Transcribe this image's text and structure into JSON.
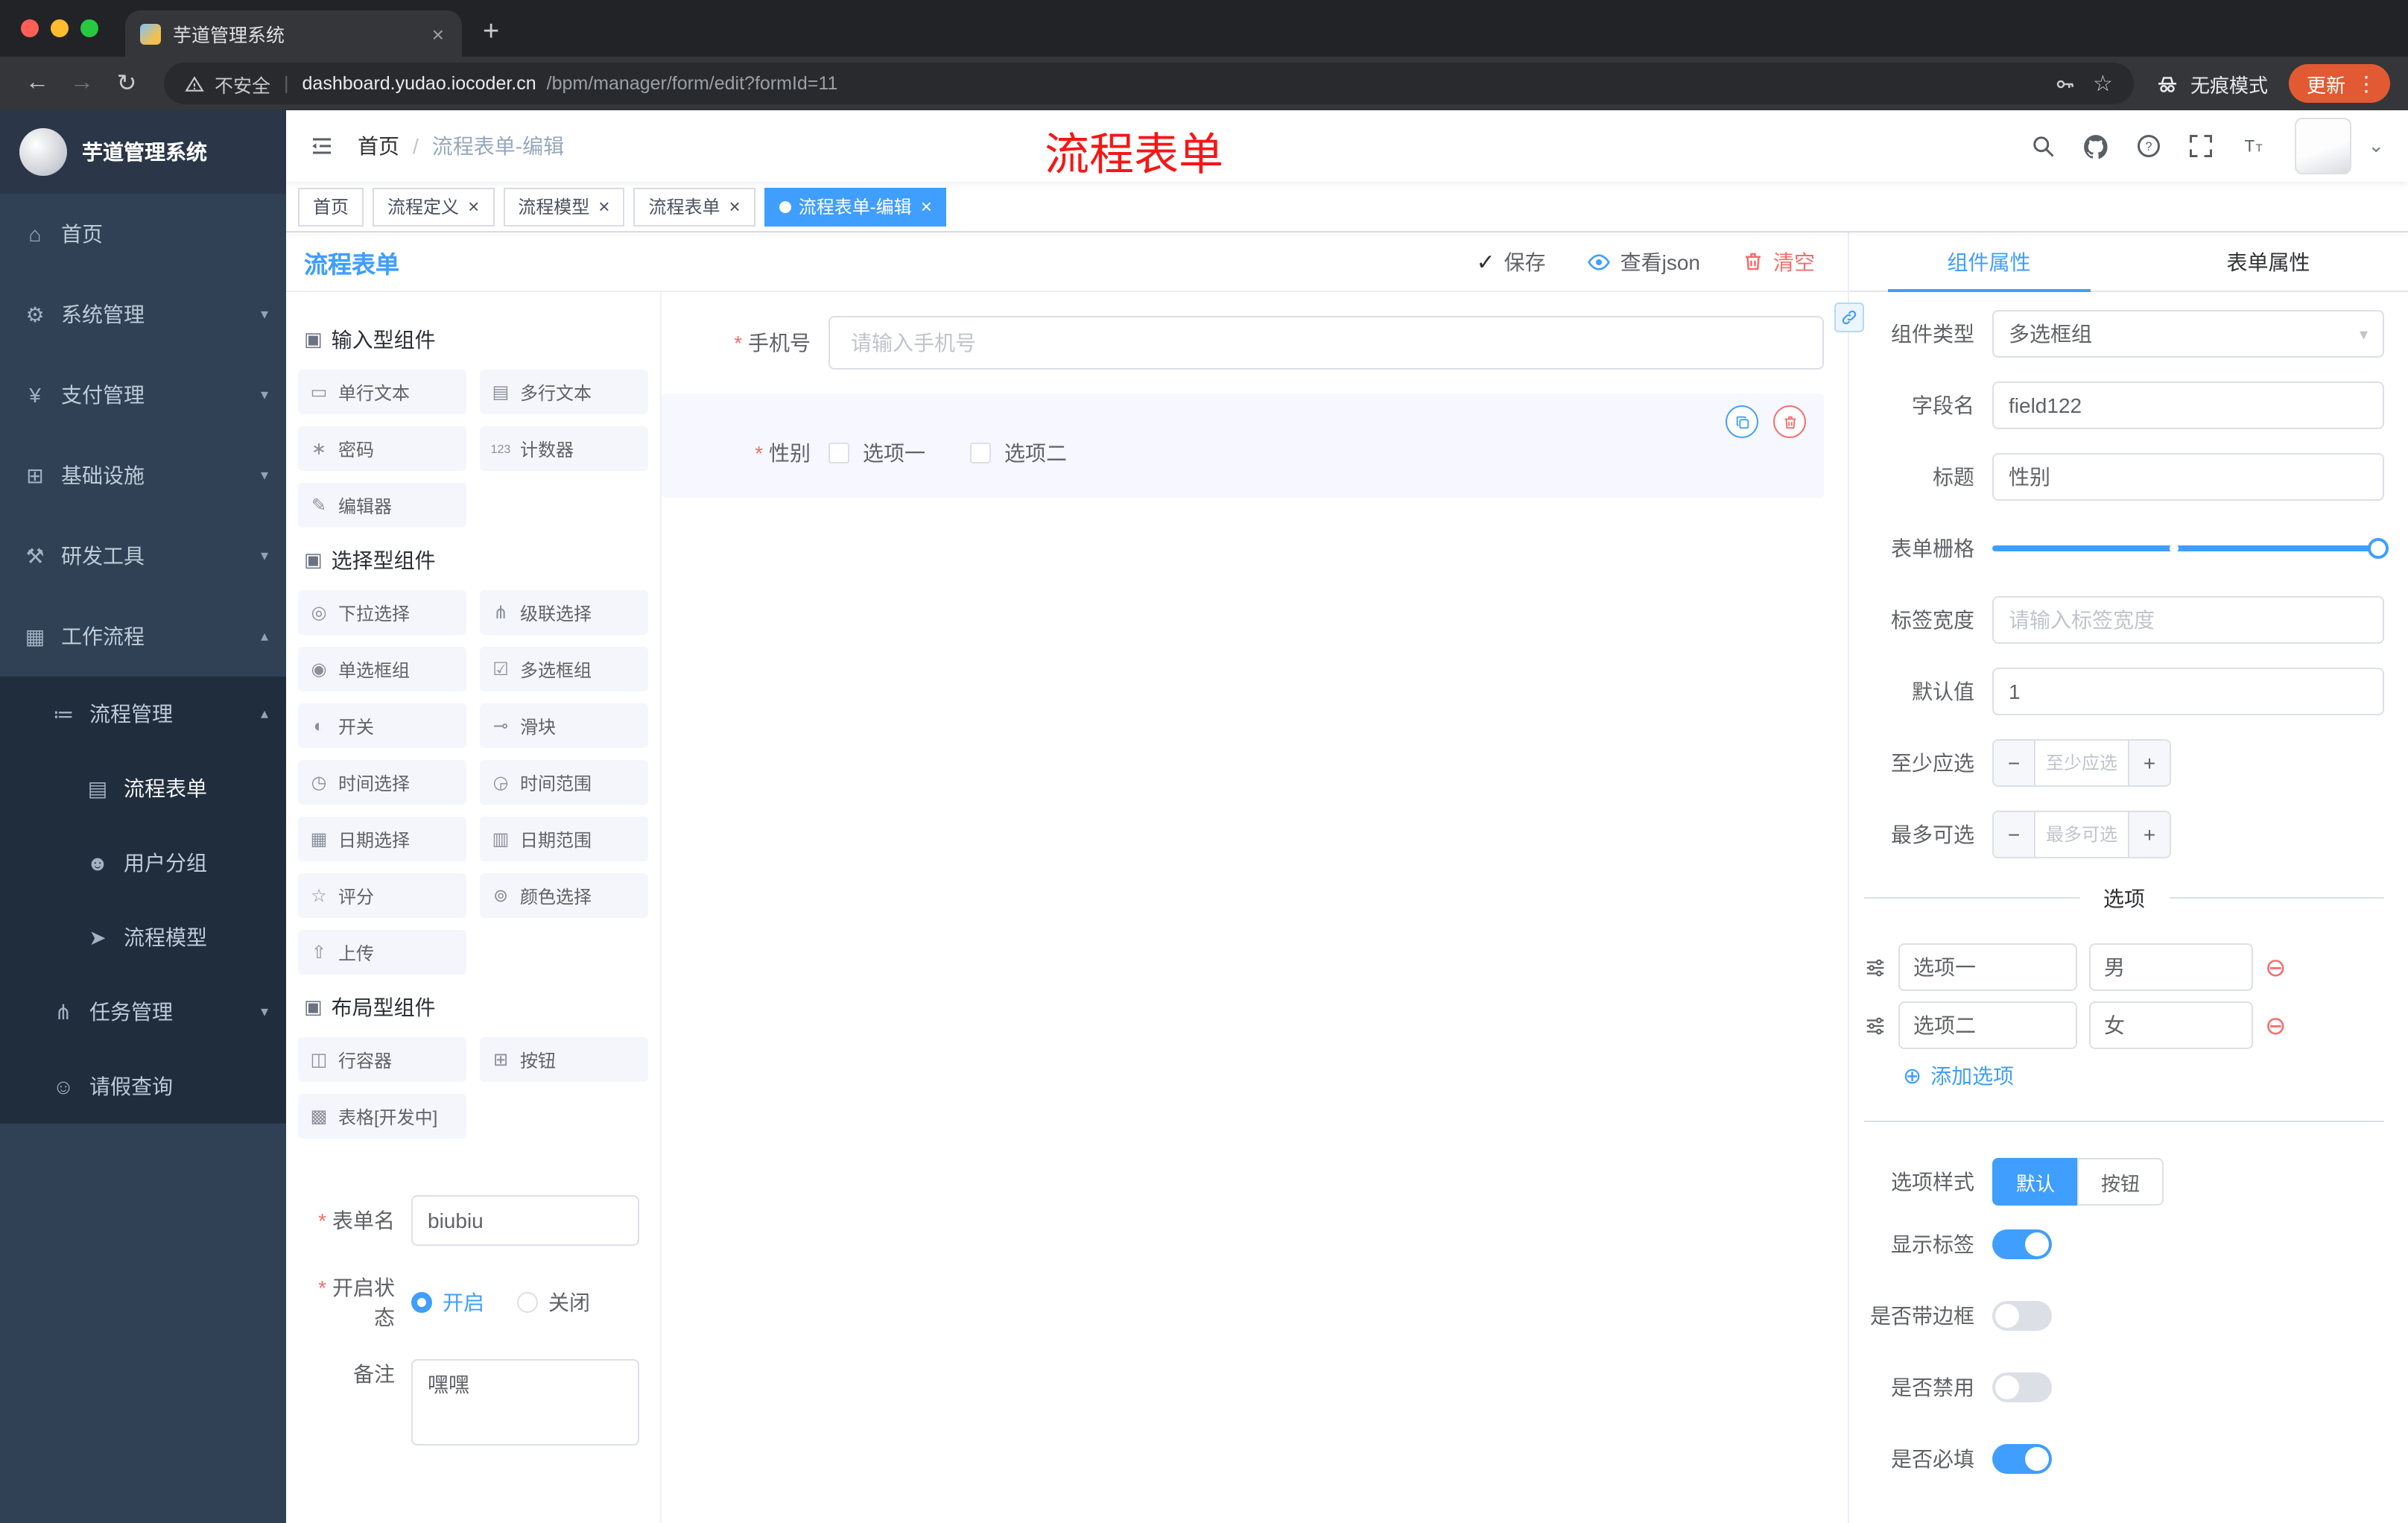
{
  "accent": "#409eff",
  "annotation_title": "流程表单",
  "browser": {
    "tab_title": "芋道管理系统",
    "security_label": "不安全",
    "url_host": "dashboard.yudao.iocoder.cn",
    "url_path": "/bpm/manager/form/edit?formId=11",
    "incognito_label": "无痕模式",
    "update_label": "更新"
  },
  "sidebar": {
    "logo_title": "芋道管理系统",
    "items": [
      {
        "icon": "⌂",
        "label": "首页",
        "arrow": ""
      },
      {
        "icon": "⚙",
        "label": "系统管理",
        "arrow": "▾"
      },
      {
        "icon": "¥",
        "label": "支付管理",
        "arrow": "▾"
      },
      {
        "icon": "⊞",
        "label": "基础设施",
        "arrow": "▾"
      },
      {
        "icon": "⚒",
        "label": "研发工具",
        "arrow": "▾"
      },
      {
        "icon": "▦",
        "label": "工作流程",
        "arrow": "▴"
      },
      {
        "icon": "≔",
        "label": "流程管理",
        "arrow": "▴"
      },
      {
        "icon": "▤",
        "label": "流程表单",
        "arrow": ""
      },
      {
        "icon": "☻",
        "label": "用户分组",
        "arrow": ""
      },
      {
        "icon": "➤",
        "label": "流程模型",
        "arrow": ""
      },
      {
        "icon": "⋔",
        "label": "任务管理",
        "arrow": "▾"
      },
      {
        "icon": "☺",
        "label": "请假查询",
        "arrow": ""
      }
    ]
  },
  "header": {
    "breadcrumb_home": "首页",
    "breadcrumb_sep": "/",
    "breadcrumb_current": "流程表单-编辑"
  },
  "tags": [
    {
      "label": "首页"
    },
    {
      "label": "流程定义"
    },
    {
      "label": "流程模型"
    },
    {
      "label": "流程表单"
    },
    {
      "label": "流程表单-编辑"
    }
  ],
  "designer": {
    "title": "流程表单",
    "actions": {
      "save": "保存",
      "view_json": "查看json",
      "clear": "清空"
    },
    "palette": {
      "groups": [
        {
          "title": "输入型组件",
          "items": [
            {
              "icon": "▭",
              "label": "单行文本"
            },
            {
              "icon": "▤",
              "label": "多行文本"
            },
            {
              "icon": "∗",
              "label": "密码"
            },
            {
              "icon": "123",
              "label": "计数器"
            },
            {
              "icon": "✎",
              "label": "编辑器"
            }
          ]
        },
        {
          "title": "选择型组件",
          "items": [
            {
              "icon": "◎",
              "label": "下拉选择"
            },
            {
              "icon": "⋔",
              "label": "级联选择"
            },
            {
              "icon": "◉",
              "label": "单选框组"
            },
            {
              "icon": "☑",
              "label": "多选框组"
            },
            {
              "icon": "◐",
              "label": "开关"
            },
            {
              "icon": "⊸",
              "label": "滑块"
            },
            {
              "icon": "◷",
              "label": "时间选择"
            },
            {
              "icon": "◶",
              "label": "时间范围"
            },
            {
              "icon": "▦",
              "label": "日期选择"
            },
            {
              "icon": "▥",
              "label": "日期范围"
            },
            {
              "icon": "☆",
              "label": "评分"
            },
            {
              "icon": "⊚",
              "label": "颜色选择"
            },
            {
              "icon": "⇧",
              "label": "上传"
            }
          ]
        },
        {
          "title": "布局型组件",
          "items": [
            {
              "icon": "◫",
              "label": "行容器"
            },
            {
              "icon": "⊞",
              "label": "按钮"
            },
            {
              "icon": "▩",
              "label": "表格[开发中]"
            }
          ]
        }
      ]
    },
    "meta": {
      "name_label": "表单名",
      "name_value": "biubiu",
      "status_label": "开启状态",
      "status_on": "开启",
      "status_off": "关闭",
      "remark_label": "备注",
      "remark_value": "嘿嘿"
    },
    "canvas": {
      "phone": {
        "label": "手机号",
        "placeholder": "请输入手机号"
      },
      "gender": {
        "label": "性别",
        "options": [
          "选项一",
          "选项二"
        ]
      }
    }
  },
  "props": {
    "tab_component": "组件属性",
    "tab_form": "表单属性",
    "rows": {
      "component_type": {
        "label": "组件类型",
        "value": "多选框组"
      },
      "field_name": {
        "label": "字段名",
        "value": "field122"
      },
      "title": {
        "label": "标题",
        "value": "性别"
      },
      "grid": {
        "label": "表单栅格"
      },
      "label_width": {
        "label": "标签宽度",
        "placeholder": "请输入标签宽度"
      },
      "default": {
        "label": "默认值",
        "value": "1"
      },
      "min": {
        "label": "至少应选",
        "placeholder": "至少应选"
      },
      "max": {
        "label": "最多可选",
        "placeholder": "最多可选"
      }
    },
    "options_divider": "选项",
    "options": [
      {
        "label": "选项一",
        "value": "男"
      },
      {
        "label": "选项二",
        "value": "女"
      }
    ],
    "add_option": "添加选项",
    "style_row": {
      "label": "选项样式",
      "options": [
        "默认",
        "按钮"
      ],
      "selected": "默认"
    },
    "switches": [
      {
        "label": "显示标签",
        "on": true
      },
      {
        "label": "是否带边框",
        "on": false
      },
      {
        "label": "是否禁用",
        "on": false
      },
      {
        "label": "是否必填",
        "on": true
      }
    ]
  }
}
